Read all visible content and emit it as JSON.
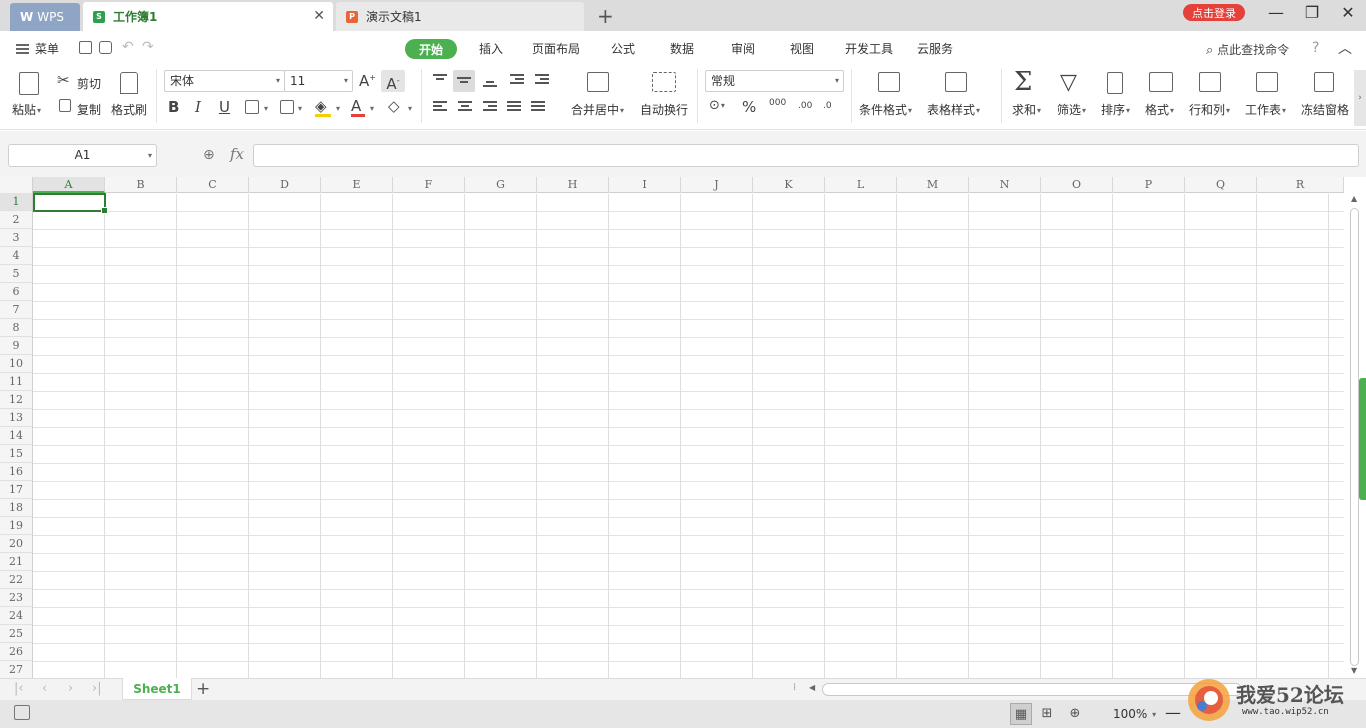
{
  "titlebar": {
    "tabs": [
      {
        "label": "WPS",
        "icon": "wps-logo-icon"
      },
      {
        "label": "工作簿1",
        "icon": "spreadsheet-icon",
        "color": "#2e7d32"
      },
      {
        "label": "演示文稿1",
        "icon": "presentation-icon",
        "color": "#e8653a"
      }
    ],
    "login_label": "点击登录",
    "colors": {
      "accent": "#4caf50",
      "login": "#e5413b",
      "wps_tab": "#8fa5c6"
    }
  },
  "menubar": {
    "menu_label": "菜单",
    "tabs": [
      "开始",
      "插入",
      "页面布局",
      "公式",
      "数据",
      "审阅",
      "视图",
      "开发工具",
      "云服务"
    ],
    "active_tab": "开始",
    "search_label": "点此查找命令"
  },
  "ribbon": {
    "paste": "粘贴",
    "cut": "剪切",
    "copy": "复制",
    "format_painter": "格式刷",
    "font_name": "宋体",
    "font_size": "11",
    "bold": "B",
    "italic": "I",
    "underline": "U",
    "font_color_letter": "A",
    "merge_center": "合并居中",
    "wrap_text": "自动换行",
    "number_format": "常规",
    "currency": "¥",
    "percent": "%",
    "thousands": "000",
    "inc_decimal": ".00",
    "conditional_format": "条件格式",
    "table_style": "表格样式",
    "sum": "求和",
    "filter": "筛选",
    "sort": "排序",
    "format": "格式",
    "rows_cols": "行和列",
    "worksheet": "工作表",
    "freeze_panes": "冻结窗格"
  },
  "formula_bar": {
    "name_box": "A1",
    "fx_label": "fx",
    "formula": ""
  },
  "grid": {
    "columns": [
      "A",
      "B",
      "C",
      "D",
      "E",
      "F",
      "G",
      "H",
      "I",
      "J",
      "K",
      "L",
      "M",
      "N",
      "O",
      "P",
      "Q",
      "R"
    ],
    "rows": [
      "1",
      "2",
      "3",
      "4",
      "5",
      "6",
      "7",
      "8",
      "9",
      "10",
      "11",
      "12",
      "13",
      "14",
      "15",
      "16",
      "17",
      "18",
      "19",
      "20",
      "21",
      "22",
      "23",
      "24",
      "25",
      "26",
      "27"
    ],
    "active_cell": "A1"
  },
  "sheets": {
    "tabs": [
      "Sheet1"
    ],
    "active": "Sheet1"
  },
  "statusbar": {
    "zoom": "100%"
  },
  "watermark": {
    "text": "我爱52论坛",
    "url": "www.tao.wip52.cn"
  }
}
